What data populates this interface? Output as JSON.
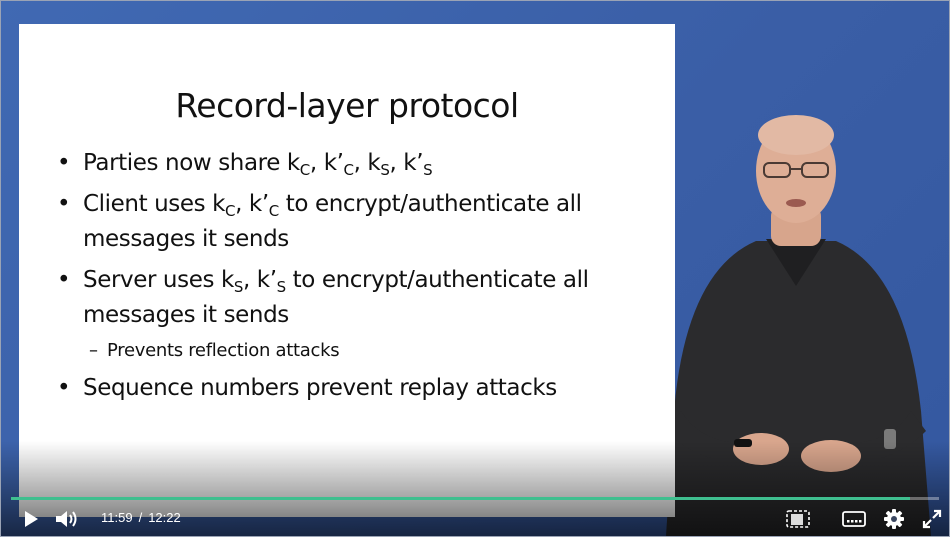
{
  "slide": {
    "title": "Record-layer protocol",
    "bullets": [
      {
        "pre": "Parties now share k",
        "s1": "C",
        "m1": ", k’",
        "s2": "C",
        "m2": ", k",
        "s3": "S",
        "m3": ", k’",
        "s4": "S",
        "post": ""
      },
      {
        "pre": "Client uses k",
        "s1": "C",
        "m1": ", k’",
        "s2": "C",
        "post": " to encrypt/authenticate all messages it sends"
      },
      {
        "pre": "Server uses k",
        "s1": "S",
        "m1": ", k’",
        "s2": "S",
        "post": " to encrypt/authenticate all messages it sends"
      },
      {
        "text": "Sequence numbers prevent replay attacks"
      }
    ],
    "sub_bullet": "Prevents reflection attacks"
  },
  "player": {
    "current_time": "11:59",
    "separator": "/",
    "duration": "12:22",
    "progress": 0.969,
    "accent_color": "#3fbf8f",
    "icons": [
      "play-icon",
      "volume-icon",
      "pip-icon",
      "captions-icon",
      "settings-icon",
      "fullscreen-icon"
    ]
  }
}
